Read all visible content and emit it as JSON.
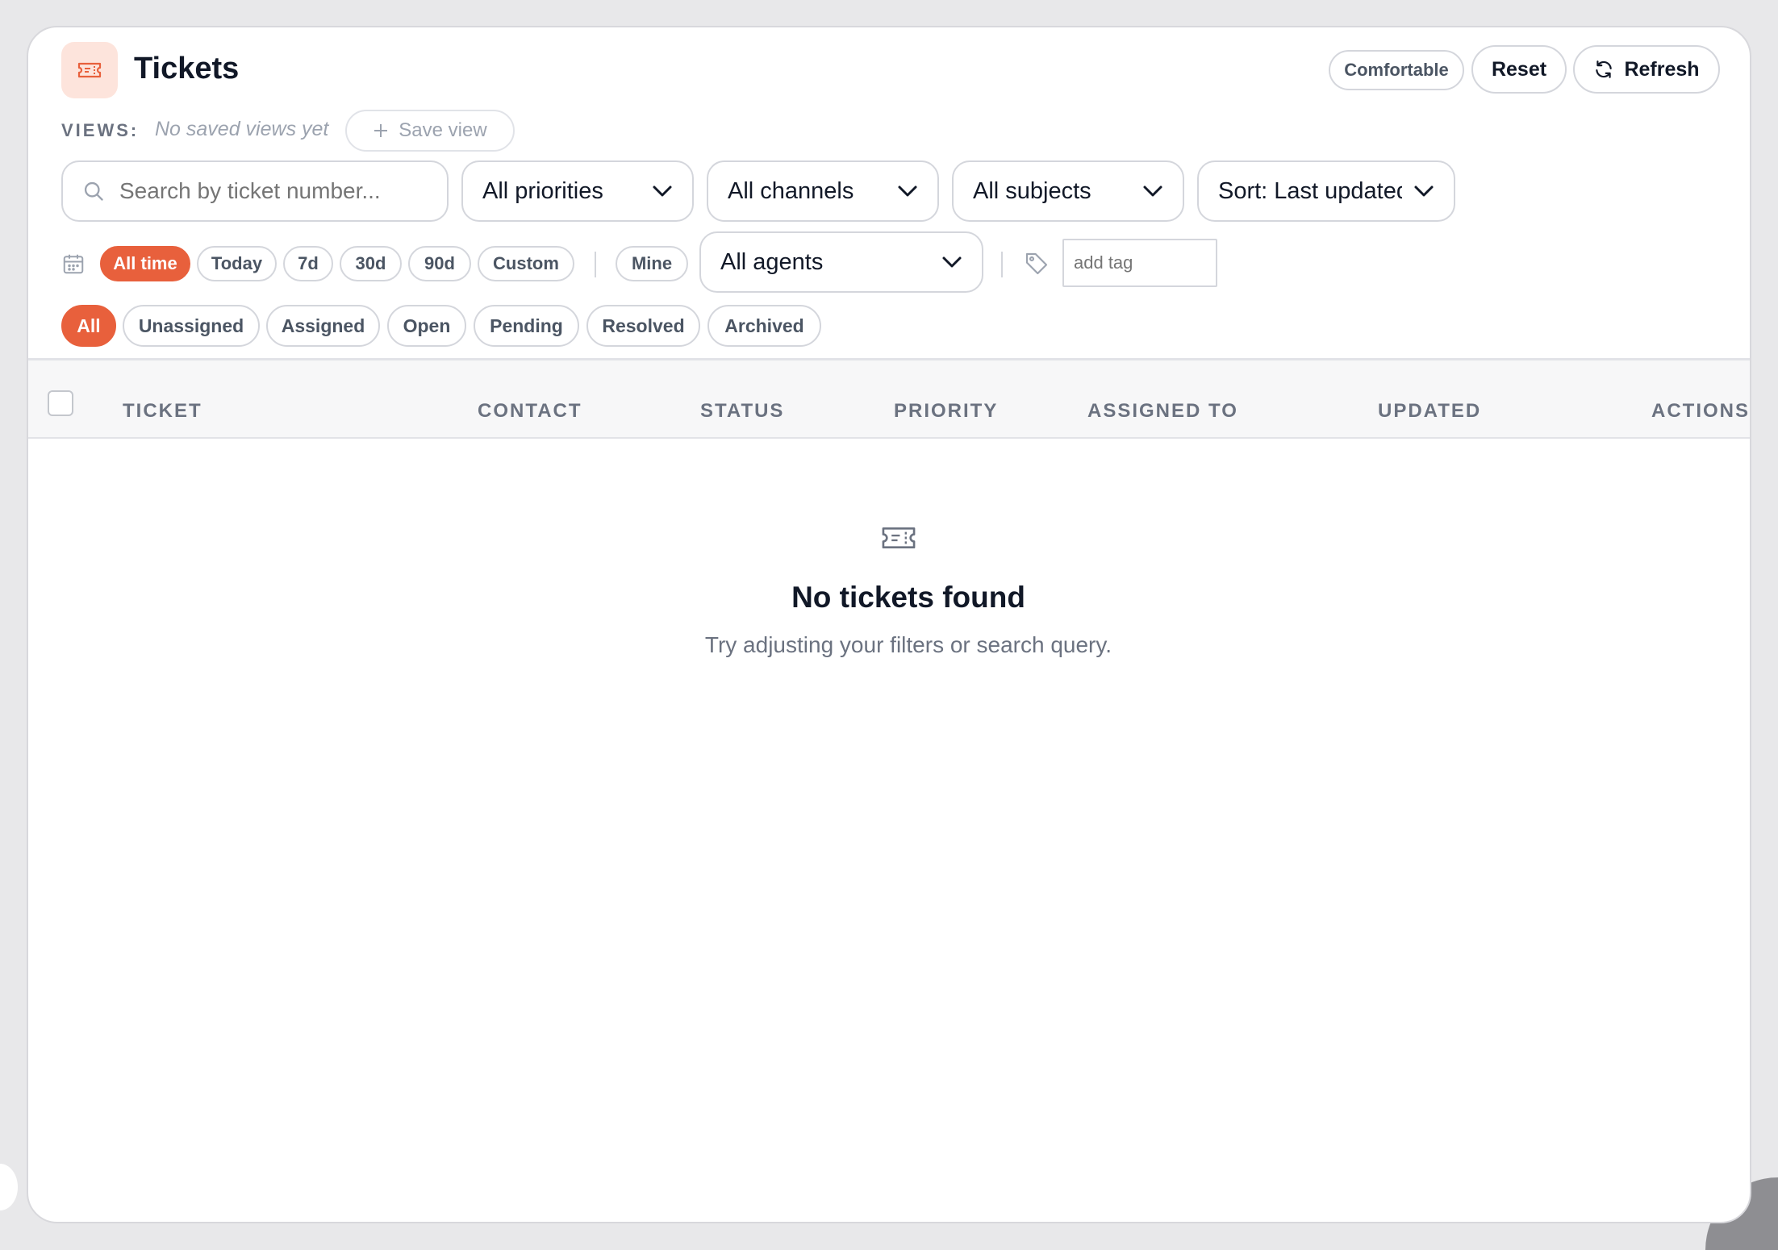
{
  "header": {
    "title": "Tickets",
    "density_label": "Comfortable",
    "reset_label": "Reset",
    "refresh_label": "Refresh"
  },
  "views": {
    "label": "VIEWS:",
    "empty_text": "No saved views yet",
    "save_label": "Save view"
  },
  "filters": {
    "search_placeholder": "Search by ticket number...",
    "priority": "All priorities",
    "channel": "All channels",
    "subject": "All subjects",
    "sort": "Sort: Last updated"
  },
  "time_ranges": [
    {
      "label": "All time",
      "active": true
    },
    {
      "label": "Today",
      "active": false
    },
    {
      "label": "7d",
      "active": false
    },
    {
      "label": "30d",
      "active": false
    },
    {
      "label": "90d",
      "active": false
    },
    {
      "label": "Custom",
      "active": false
    }
  ],
  "mine_label": "Mine",
  "agent_filter": "All agents",
  "tag_placeholder": "add tag",
  "status_tabs": [
    {
      "label": "All",
      "active": true
    },
    {
      "label": "Unassigned",
      "active": false
    },
    {
      "label": "Assigned",
      "active": false
    },
    {
      "label": "Open",
      "active": false
    },
    {
      "label": "Pending",
      "active": false
    },
    {
      "label": "Resolved",
      "active": false
    },
    {
      "label": "Archived",
      "active": false
    }
  ],
  "table": {
    "columns": [
      "TICKET",
      "CONTACT",
      "STATUS",
      "PRIORITY",
      "ASSIGNED TO",
      "UPDATED",
      "ACTIONS"
    ]
  },
  "empty_state": {
    "title": "No tickets found",
    "subtitle": "Try adjusting your filters or search query."
  },
  "colors": {
    "accent": "#e8603c",
    "accent_soft": "#fde4dc",
    "border": "#d4d6dc",
    "muted_text": "#6b7280"
  }
}
